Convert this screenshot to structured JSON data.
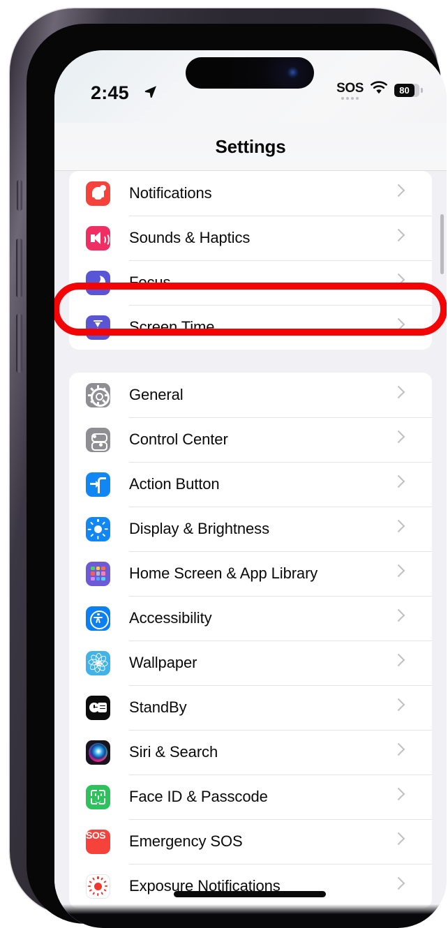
{
  "device": {
    "model_style": "iphone-15-pro"
  },
  "status_bar": {
    "time": "2:45",
    "location_icon": "location-arrow-icon",
    "sos_label": "SOS",
    "wifi_icon": "wifi-icon",
    "battery_percent": "80",
    "battery_level": 80
  },
  "nav": {
    "title": "Settings"
  },
  "annotation": {
    "type": "red-oval-highlight",
    "target": "Focus",
    "color": "#f40505"
  },
  "groups": [
    {
      "id": "group-alerts",
      "rows": [
        {
          "label": "Notifications",
          "icon": "bell-icon",
          "icon_bg": "#f5423a",
          "chevron": "chevron-right-icon"
        },
        {
          "label": "Sounds & Haptics",
          "icon": "speaker-wave-icon",
          "icon_bg": "#ef2f63",
          "chevron": "chevron-right-icon"
        },
        {
          "label": "Focus",
          "icon": "crescent-moon-icon",
          "icon_bg": "#5856d6",
          "chevron": "chevron-right-icon",
          "highlighted": true
        },
        {
          "label": "Screen Time",
          "icon": "hourglass-icon",
          "icon_bg": "#5a56d3",
          "chevron": "chevron-right-icon"
        }
      ]
    },
    {
      "id": "group-system",
      "rows": [
        {
          "label": "General",
          "icon": "gear-icon",
          "icon_bg": "#8e8e93",
          "chevron": "chevron-right-icon"
        },
        {
          "label": "Control Center",
          "icon": "toggles-icon",
          "icon_bg": "#8e8e93",
          "chevron": "chevron-right-icon"
        },
        {
          "label": "Action Button",
          "icon": "action-button-icon",
          "icon_bg": "#1187f5",
          "chevron": "chevron-right-icon"
        },
        {
          "label": "Display & Brightness",
          "icon": "sun-icon",
          "icon_bg": "#1187f5",
          "chevron": "chevron-right-icon"
        },
        {
          "label": "Home Screen & App Library",
          "icon": "app-grid-icon",
          "icon_bg": "#6e5ad6",
          "chevron": "chevron-right-icon"
        },
        {
          "label": "Accessibility",
          "icon": "accessibility-icon",
          "icon_bg": "#0c7ff2",
          "chevron": "chevron-right-icon"
        },
        {
          "label": "Wallpaper",
          "icon": "flower-icon",
          "icon_bg": "#42b3e8",
          "chevron": "chevron-right-icon"
        },
        {
          "label": "StandBy",
          "icon": "standby-icon",
          "icon_bg": "#0c0c0c",
          "chevron": "chevron-right-icon"
        },
        {
          "label": "Siri & Search",
          "icon": "siri-orb-icon",
          "icon_bg": "#1a1320",
          "chevron": "chevron-right-icon"
        },
        {
          "label": "Face ID & Passcode",
          "icon": "face-id-icon",
          "icon_bg": "#2ec25c",
          "chevron": "chevron-right-icon"
        },
        {
          "label": "Emergency SOS",
          "icon": "sos-icon",
          "icon_bg": "#f5423a",
          "chevron": "chevron-right-icon"
        },
        {
          "label": "Exposure Notifications",
          "icon": "exposure-dot-icon",
          "icon_bg": "#ffffff",
          "chevron": "chevron-right-icon"
        }
      ]
    }
  ]
}
